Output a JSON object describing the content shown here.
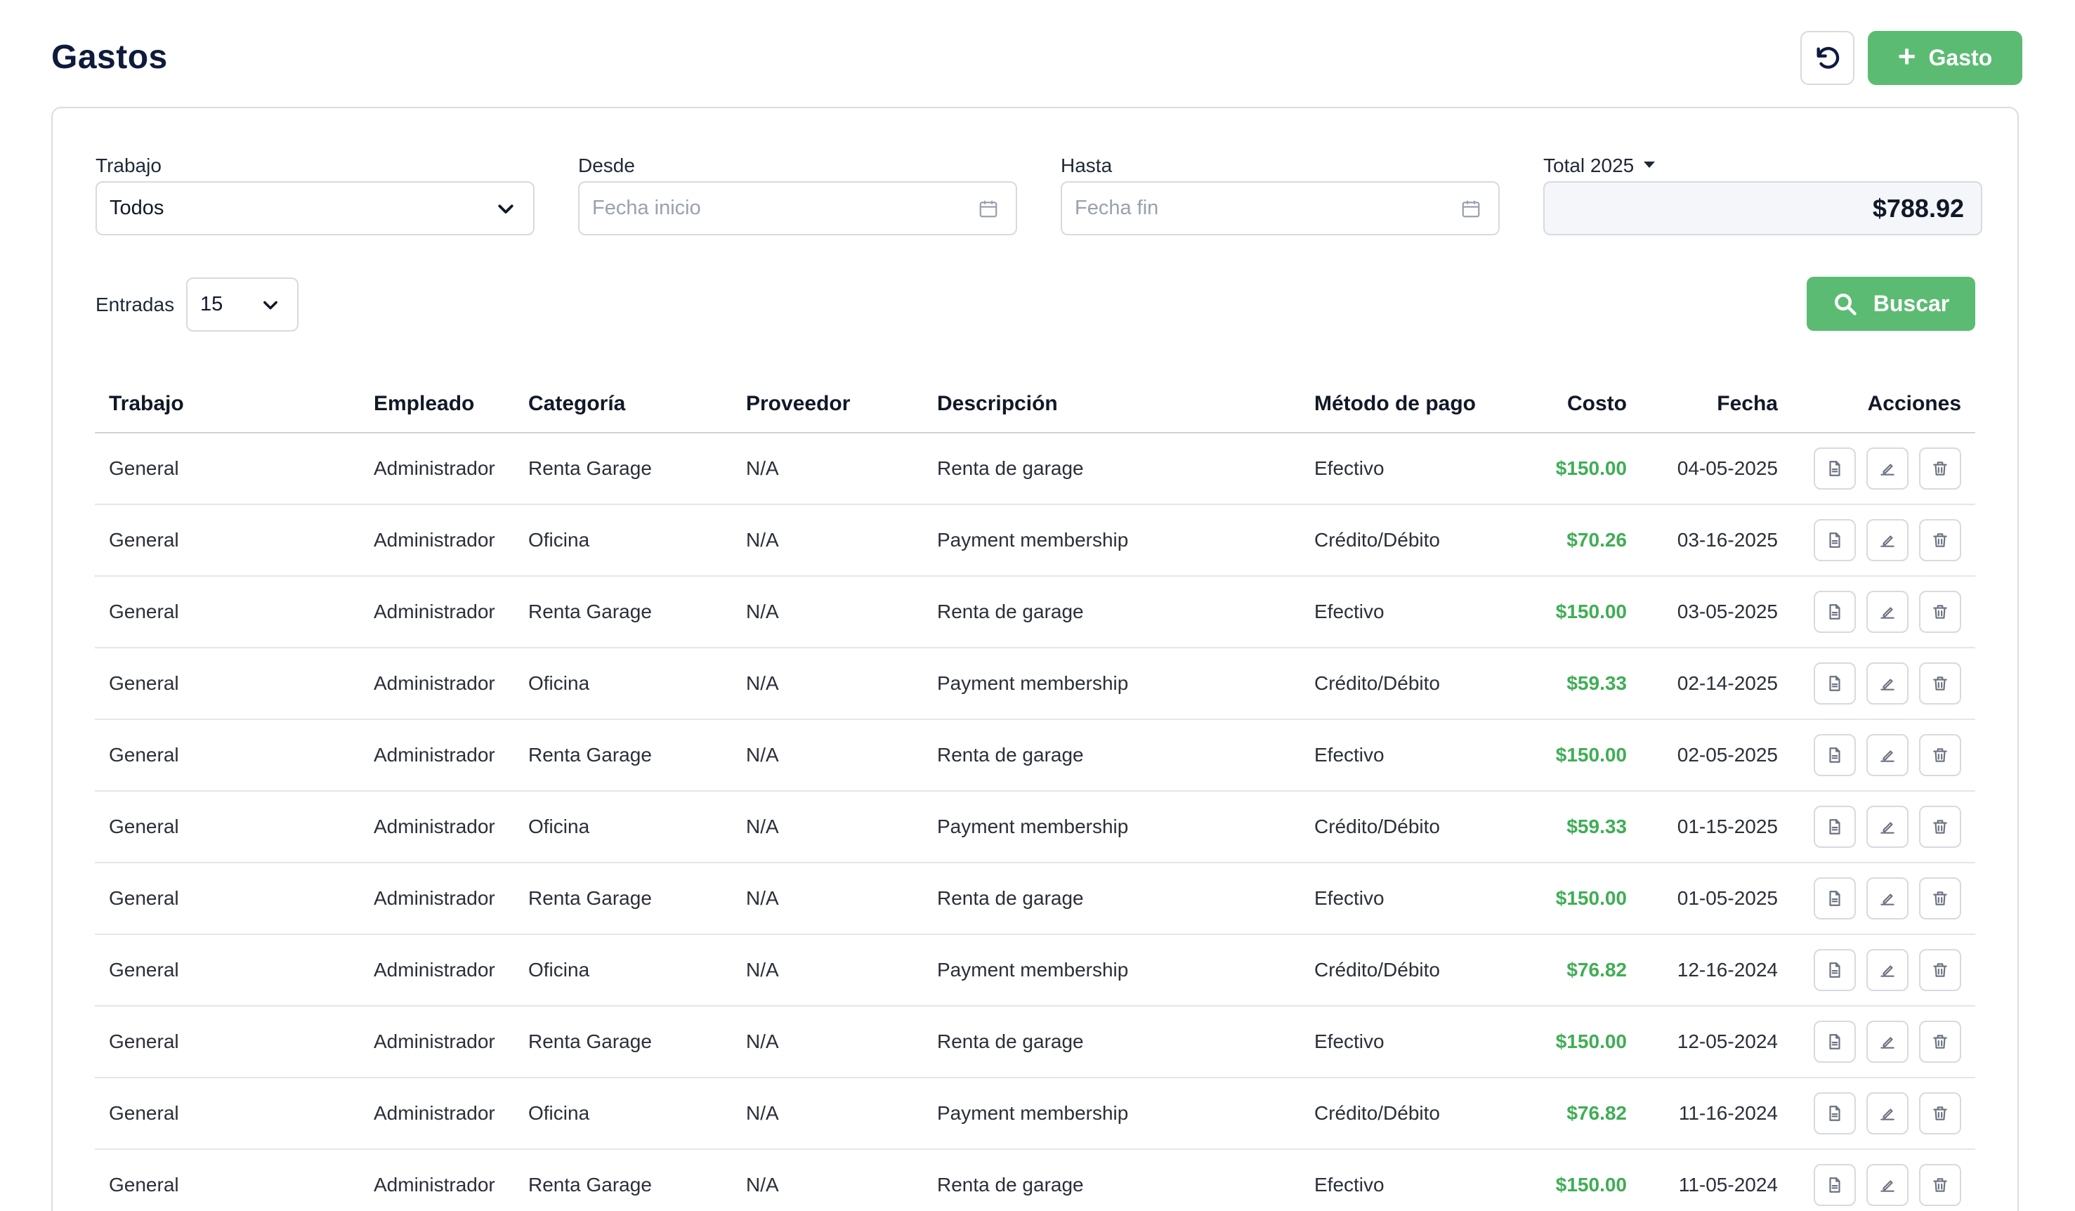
{
  "header": {
    "title": "Gastos",
    "add_label": "Gasto"
  },
  "filters": {
    "trabajo_label": "Trabajo",
    "trabajo_value": "Todos",
    "desde_label": "Desde",
    "desde_placeholder": "Fecha inicio",
    "hasta_label": "Hasta",
    "hasta_placeholder": "Fecha fin",
    "total_label": "Total 2025",
    "total_value": "$788.92",
    "entradas_label": "Entradas",
    "entradas_value": "15",
    "buscar_label": "Buscar"
  },
  "table": {
    "columns": [
      "Trabajo",
      "Empleado",
      "Categoría",
      "Proveedor",
      "Descripción",
      "Método de pago",
      "Costo",
      "Fecha",
      "Acciones"
    ],
    "rows": [
      [
        "General",
        "Administrador",
        "Renta Garage",
        "N/A",
        "Renta de garage",
        "Efectivo",
        "$150.00",
        "04-05-2025"
      ],
      [
        "General",
        "Administrador",
        "Oficina",
        "N/A",
        "Payment membership",
        "Crédito/Débito",
        "$70.26",
        "03-16-2025"
      ],
      [
        "General",
        "Administrador",
        "Renta Garage",
        "N/A",
        "Renta de garage",
        "Efectivo",
        "$150.00",
        "03-05-2025"
      ],
      [
        "General",
        "Administrador",
        "Oficina",
        "N/A",
        "Payment membership",
        "Crédito/Débito",
        "$59.33",
        "02-14-2025"
      ],
      [
        "General",
        "Administrador",
        "Renta Garage",
        "N/A",
        "Renta de garage",
        "Efectivo",
        "$150.00",
        "02-05-2025"
      ],
      [
        "General",
        "Administrador",
        "Oficina",
        "N/A",
        "Payment membership",
        "Crédito/Débito",
        "$59.33",
        "01-15-2025"
      ],
      [
        "General",
        "Administrador",
        "Renta Garage",
        "N/A",
        "Renta de garage",
        "Efectivo",
        "$150.00",
        "01-05-2025"
      ],
      [
        "General",
        "Administrador",
        "Oficina",
        "N/A",
        "Payment membership",
        "Crédito/Débito",
        "$76.82",
        "12-16-2024"
      ],
      [
        "General",
        "Administrador",
        "Renta Garage",
        "N/A",
        "Renta de garage",
        "Efectivo",
        "$150.00",
        "12-05-2024"
      ],
      [
        "General",
        "Administrador",
        "Oficina",
        "N/A",
        "Payment membership",
        "Crédito/Débito",
        "$76.82",
        "11-16-2024"
      ],
      [
        "General",
        "Administrador",
        "Renta Garage",
        "N/A",
        "Renta de garage",
        "Efectivo",
        "$150.00",
        "11-05-2024"
      ]
    ]
  },
  "icons": {
    "refresh": "refresh-icon",
    "add": "plus-icon",
    "calendar": "calendar-icon",
    "chevron": "chevron-down-icon",
    "search": "search-icon",
    "row_actions": [
      "file-icon",
      "edit-icon",
      "trash-icon"
    ]
  },
  "colors": {
    "accent": "#5cbb72",
    "cost": "#3fae55",
    "title": "#0f1b3d"
  }
}
